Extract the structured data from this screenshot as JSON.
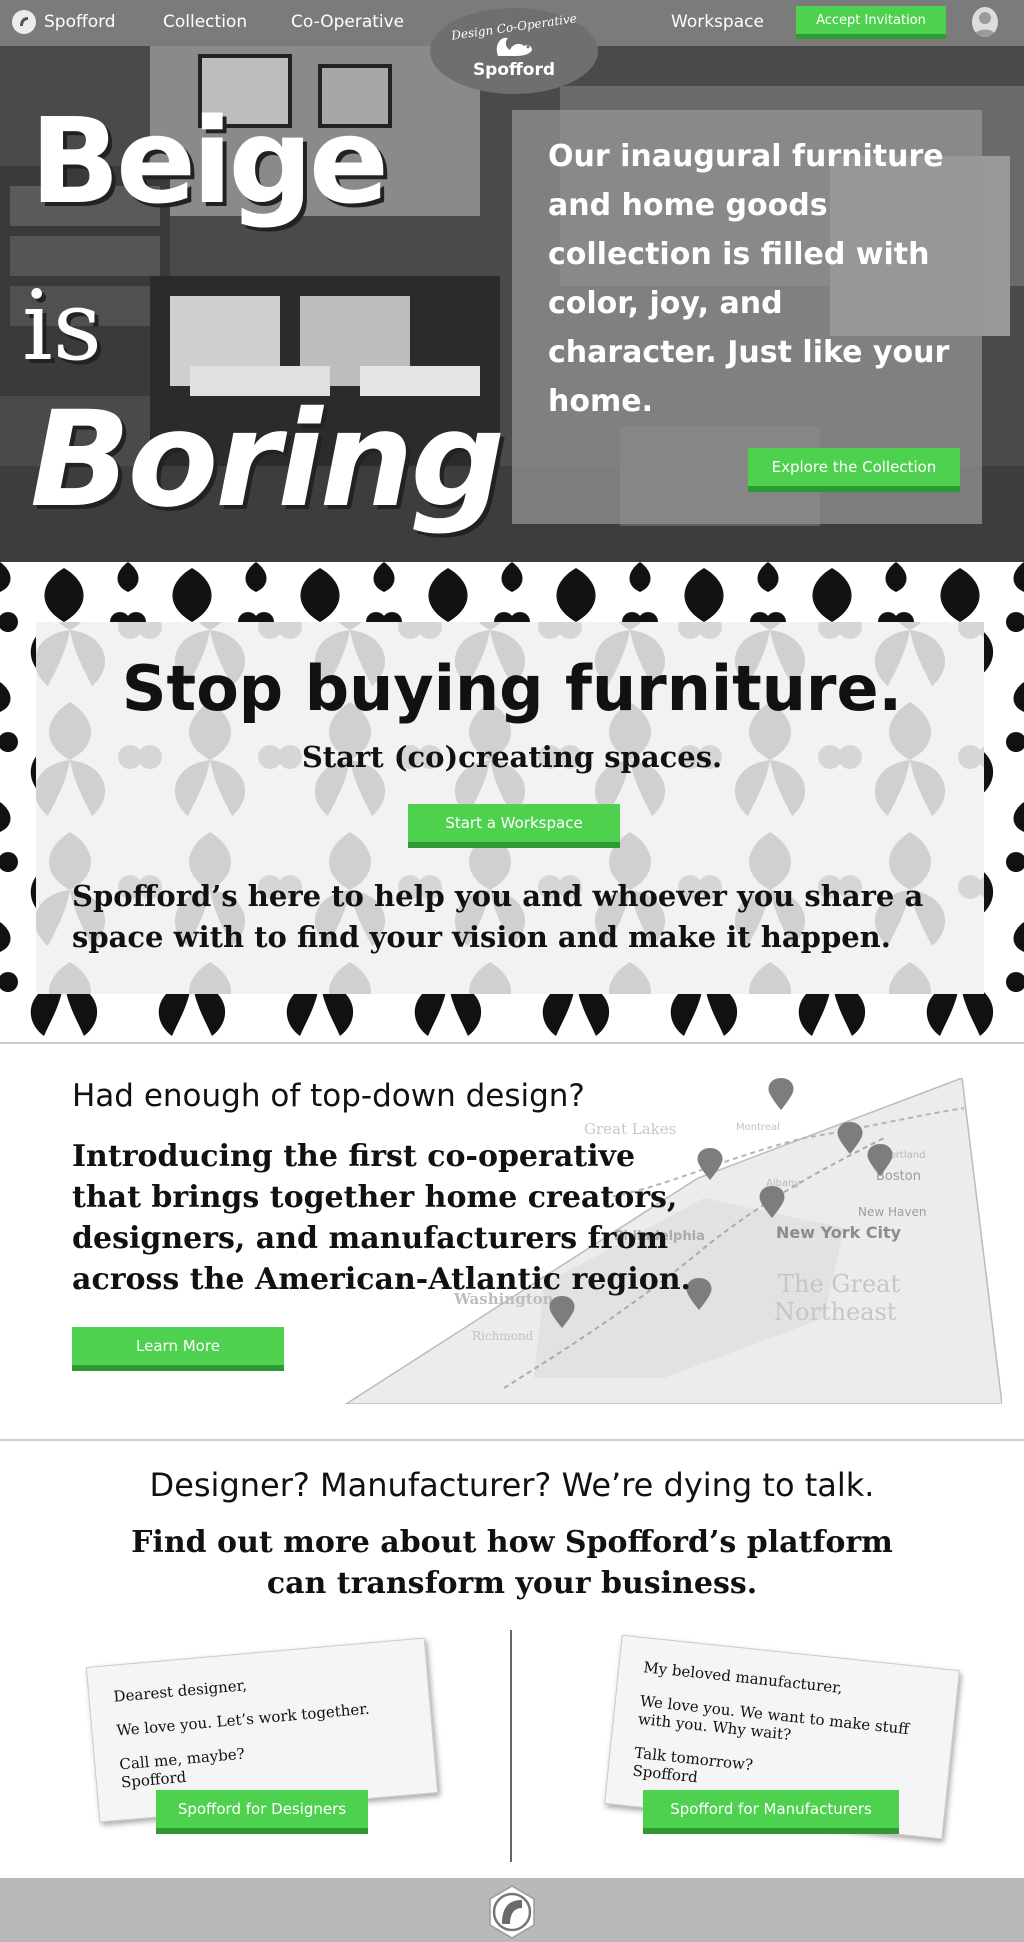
{
  "nav": {
    "brand": "Spofford",
    "links": [
      "Collection",
      "Co-Operative"
    ],
    "workspace": "Workspace",
    "accept_invitation": "Accept Invitation",
    "emblem_top": "Design Co-Operative",
    "emblem_name": "Spofford"
  },
  "hero": {
    "word1": "Beige",
    "word2": "is",
    "word3": "Boring",
    "tagline": "Our inaugural furniture and home goods collection is filled with color, joy, and character. Just like your home.",
    "cta": "Explore the Collection"
  },
  "cocreate": {
    "title": "Stop buying furniture.",
    "subtitle": "Start (co)creating spaces.",
    "cta": "Start a Workspace",
    "body": "Spofford’s here to help you and whoever you share a space with to find your vision and make it happen."
  },
  "coop": {
    "heading": "Had enough of top-down design?",
    "body": "Introducing the first co-operative that brings together home creators, designers, and manufacturers from across the American-Atlantic region.",
    "cta": "Learn More",
    "map_labels": {
      "great_lakes": "Great Lakes",
      "montreal": "Montreal",
      "portland": "Portland",
      "boston": "Boston",
      "albany": "Albany",
      "new_haven": "New Haven",
      "new_york_city": "New York City",
      "philadelphia": "Philadelphia",
      "washington": "Washington",
      "richmond": "Richmond",
      "region_line1": "The Great",
      "region_line2": "Northeast"
    }
  },
  "partners": {
    "heading": "Designer? Manufacturer? We’re dying to talk.",
    "subheading": "Find out more about how Spofford’s platform can transform your business.",
    "designer_card": {
      "greeting": "Dearest designer,",
      "line1": "We love you. Let’s work together.",
      "line2": "Call me, maybe?",
      "signoff": "Spofford"
    },
    "manufacturer_card": {
      "greeting": "My beloved manufacturer,",
      "line1": "We love you. We want to make stuff with you. Why wait?",
      "line2": "Talk tomorrow?",
      "signoff": "Spofford"
    },
    "designers_cta": "Spofford for Designers",
    "manufacturers_cta": "Spofford for Manufacturers"
  },
  "colors": {
    "accent_green": "#4ed14f",
    "accent_green_dark": "#2f9a33",
    "nav_gray": "#7b7b7b",
    "footer_gray": "#b9b9b9"
  },
  "icons": [
    "spofford-logo-icon",
    "squirrel-icon",
    "user-avatar-icon",
    "map-pin-icon"
  ]
}
